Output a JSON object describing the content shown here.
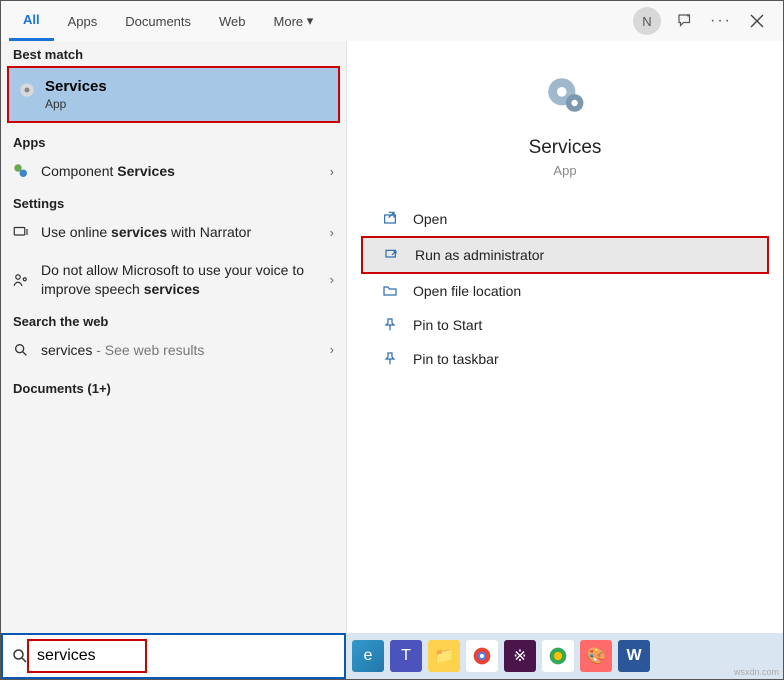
{
  "tabs": {
    "all": "All",
    "apps": "Apps",
    "documents": "Documents",
    "web": "Web",
    "more": "More"
  },
  "top": {
    "avatar_initial": "N"
  },
  "left": {
    "bestmatch_label": "Best match",
    "bestmatch": {
      "title": "Services",
      "subtitle": "App"
    },
    "apps_label": "Apps",
    "component_services_pre": "Component ",
    "component_services_bold": "Services",
    "settings_label": "Settings",
    "setting1_pre": "Use online ",
    "setting1_bold": "services",
    "setting1_post": " with Narrator",
    "setting2_pre": "Do not allow Microsoft to use your voice to improve speech ",
    "setting2_bold": "services",
    "searchweb_label": "Search the web",
    "web_result_pre": "services",
    "web_result_post": " - See web results",
    "documents_label": "Documents (1+)"
  },
  "right": {
    "title": "Services",
    "subtitle": "App",
    "actions": {
      "open": "Open",
      "run_admin": "Run as administrator",
      "open_loc": "Open file location",
      "pin_start": "Pin to Start",
      "pin_taskbar": "Pin to taskbar"
    }
  },
  "search": {
    "value": "services"
  },
  "watermark": "wsxdn.com"
}
